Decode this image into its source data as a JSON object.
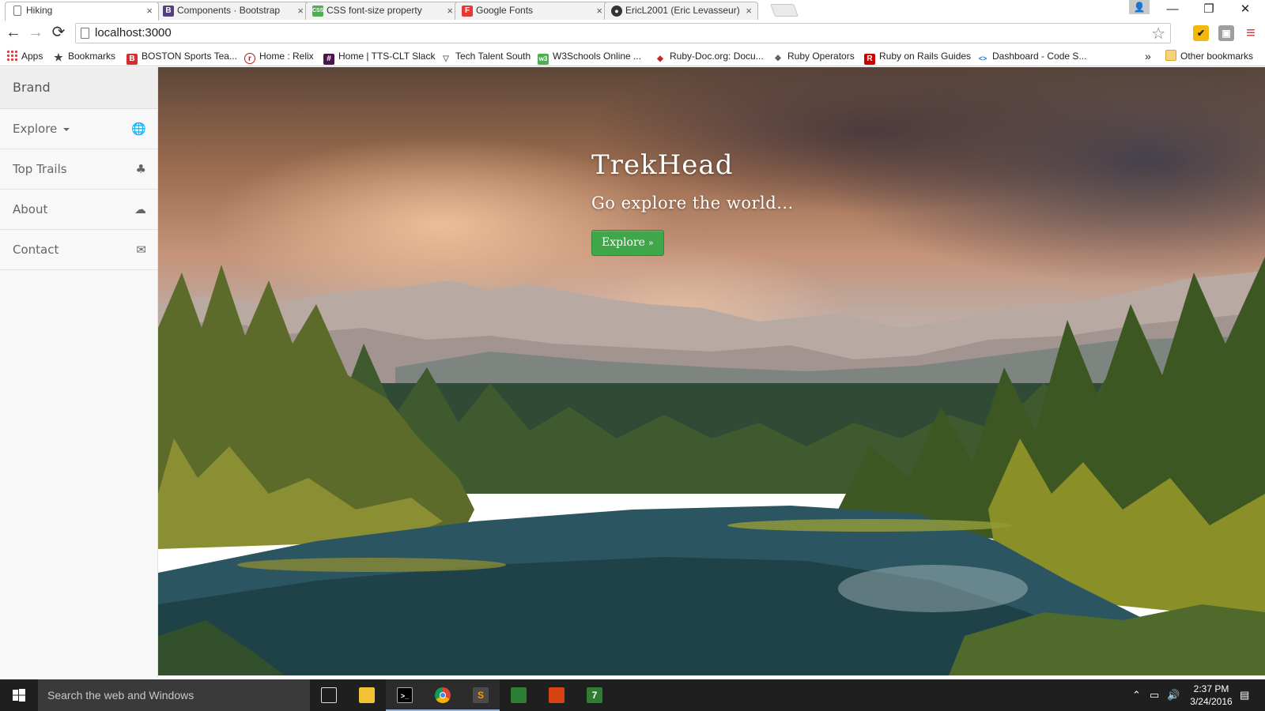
{
  "browser": {
    "tabs": [
      {
        "title": "Hiking",
        "favicon": "page-icon",
        "color": "#ffffff",
        "glyph": "",
        "active": true
      },
      {
        "title": "Components · Bootstrap",
        "favicon": "bootstrap-icon",
        "color": "#563d7c",
        "glyph": "B",
        "active": false
      },
      {
        "title": "CSS font-size property",
        "favicon": "w3schools-icon",
        "color": "#4caf50",
        "glyph": "CSS",
        "active": false
      },
      {
        "title": "Google Fonts",
        "favicon": "google-fonts-icon",
        "color": "#e53935",
        "glyph": "F",
        "active": false
      },
      {
        "title": "EricL2001 (Eric Levasseur)",
        "favicon": "github-icon",
        "color": "#333333",
        "glyph": "●",
        "active": false
      }
    ],
    "tab_close_glyph": "×",
    "window_controls": {
      "minimize": "—",
      "restore": "❐",
      "close": "✕"
    },
    "profile_glyph": "👤",
    "nav": {
      "back": "←",
      "forward": "→",
      "reload": "⟳"
    },
    "url": "localhost:3000",
    "star_glyph": "☆",
    "extensions": [
      {
        "name": "norton-extension-icon",
        "color": "#f2b90c",
        "glyph": "✔"
      },
      {
        "name": "extension-icon",
        "color": "#9e9e9e",
        "glyph": "▣"
      }
    ],
    "menu_glyph": "≡",
    "bookmarks": [
      {
        "label": "Apps",
        "icon": "apps-grid-icon",
        "color": "",
        "glyph": ""
      },
      {
        "label": "Bookmarks",
        "icon": "star-icon",
        "color": "#444444",
        "glyph": "★"
      },
      {
        "label": "BOSTON Sports Tea...",
        "icon": "boston-icon",
        "color": "#d32f2f",
        "glyph": "B"
      },
      {
        "label": "Home : Relix",
        "icon": "relix-icon",
        "color": "#b71c1c",
        "glyph": "r"
      },
      {
        "label": "Home | TTS-CLT Slack",
        "icon": "slack-icon",
        "color": "#4a154b",
        "glyph": "#"
      },
      {
        "label": "Tech Talent South",
        "icon": "tts-icon",
        "color": "#777777",
        "glyph": "▽"
      },
      {
        "label": "W3Schools Online ...",
        "icon": "w3schools-icon",
        "color": "#4caf50",
        "glyph": "w3"
      },
      {
        "label": "Ruby-Doc.org: Docu...",
        "icon": "ruby-doc-icon",
        "color": "#c62828",
        "glyph": "◆"
      },
      {
        "label": "Ruby Operators",
        "icon": "ruby-operators-icon",
        "color": "#555555",
        "glyph": "❖"
      },
      {
        "label": "Ruby on Rails Guides",
        "icon": "rails-icon",
        "color": "#cc0000",
        "glyph": "R"
      },
      {
        "label": "Dashboard - Code S...",
        "icon": "code-school-icon",
        "color": "#1976d2",
        "glyph": "<>"
      }
    ],
    "bookmarks_overflow": "»",
    "other_bookmarks": "Other bookmarks"
  },
  "sidebar": {
    "brand": "Brand",
    "items": [
      {
        "label": "Explore",
        "icon": "globe-icon",
        "glyph": "🌐",
        "dropdown": true
      },
      {
        "label": "Top Trails",
        "icon": "tree-icon",
        "glyph": "♣",
        "dropdown": false
      },
      {
        "label": "About",
        "icon": "cloud-icon",
        "glyph": "☁",
        "dropdown": false
      },
      {
        "label": "Contact",
        "icon": "envelope-icon",
        "glyph": "✉",
        "dropdown": false
      }
    ]
  },
  "hero": {
    "title": "TrekHead",
    "subtitle": "Go explore the world...",
    "button_label": "Explore",
    "button_chevron": "»",
    "button_color": "#3fa64a"
  },
  "taskbar": {
    "search_placeholder": "Search the web and Windows",
    "apps": [
      {
        "name": "task-view-icon",
        "color": "#1f1f1f",
        "glyph": "❐",
        "open": false
      },
      {
        "name": "file-explorer-icon",
        "color": "#f2c230",
        "glyph": "▬",
        "open": false
      },
      {
        "name": "command-prompt-icon",
        "color": "#000000",
        "glyph": ">_",
        "open": true
      },
      {
        "name": "chrome-icon",
        "color": "#4285f4",
        "glyph": "◉",
        "open": true
      },
      {
        "name": "sublime-text-icon",
        "color": "#ff9800",
        "glyph": "S",
        "open": true
      },
      {
        "name": "store-icon",
        "color": "#2e7d32",
        "glyph": "🛍",
        "open": false
      },
      {
        "name": "slides-icon",
        "color": "#d84315",
        "glyph": "▤",
        "open": false
      },
      {
        "name": "7zip-icon",
        "color": "#2e7d32",
        "glyph": "7",
        "open": false
      }
    ],
    "time": "2:37 PM",
    "date": "3/24/2016"
  }
}
